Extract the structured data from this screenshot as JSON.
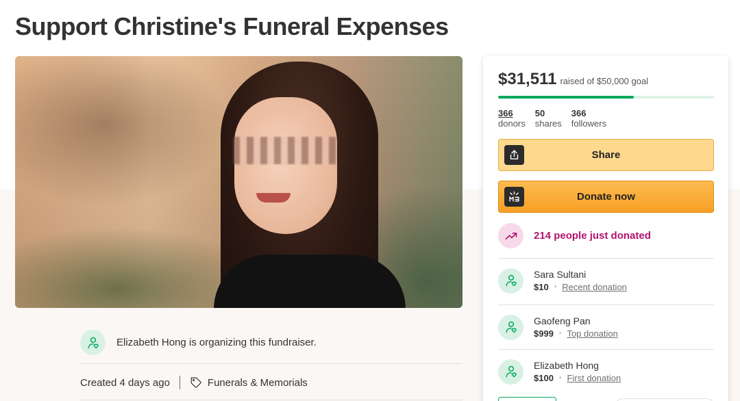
{
  "page": {
    "title": "Support Christine's Funeral Expenses"
  },
  "organizer": {
    "text": "Elizabeth Hong is organizing this fundraiser.",
    "icon": "person-heart-icon"
  },
  "meta": {
    "created": "Created 4 days ago",
    "category": "Funerals & Memorials",
    "category_icon": "tag-icon"
  },
  "donation_card": {
    "raised": "$31,511",
    "goal_text": "raised of $50,000 goal",
    "progress_fraction": 0.63,
    "stats": [
      {
        "value": "366",
        "label": "donors"
      },
      {
        "value": "50",
        "label": "shares"
      },
      {
        "value": "366",
        "label": "followers"
      }
    ],
    "share_label": "Share",
    "share_icon": "upload-icon",
    "donate_label": "Donate now",
    "donate_icon": "gofundme-logo-icon",
    "trend_text": "214 people just donated",
    "trend_icon": "trending-up-icon",
    "donors": [
      {
        "name": "Sara Sultani",
        "amount": "$10",
        "type": "Recent donation"
      },
      {
        "name": "Gaofeng Pan",
        "amount": "$999",
        "type": "Top donation"
      },
      {
        "name": "Elizabeth Hong",
        "amount": "$100",
        "type": "First donation"
      }
    ]
  },
  "colors": {
    "brand_green": "#02a95c",
    "donate_orange": "#f79f25",
    "trend_pink": "#b0136e"
  }
}
